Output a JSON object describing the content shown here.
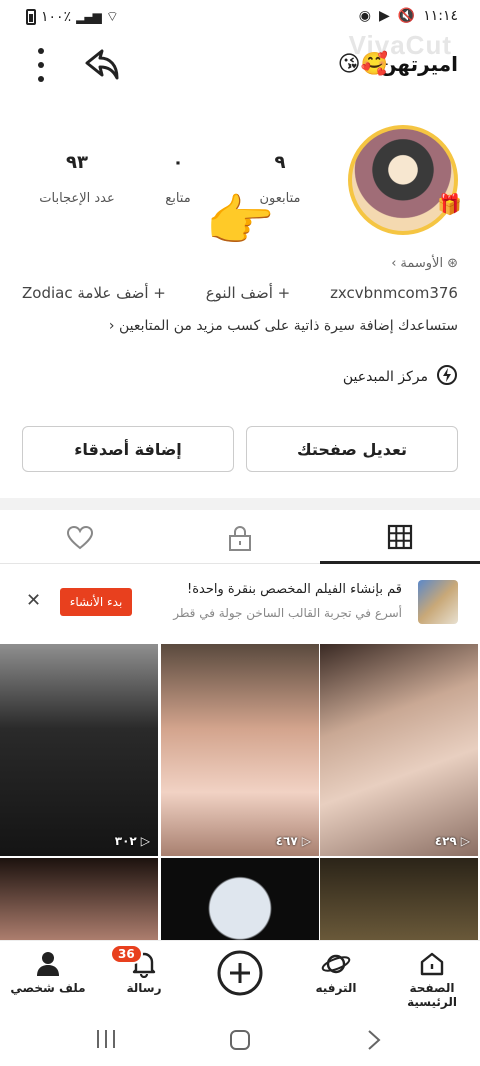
{
  "status": {
    "battery": "١٠٠٪",
    "time": "١١:١٤"
  },
  "watermark": "VivaCut",
  "profile": {
    "username": "اميرتهن",
    "emojis": "😘🥰"
  },
  "stats": [
    {
      "num": "٩",
      "label": "متابعون"
    },
    {
      "num": "٠",
      "label": "متابع"
    },
    {
      "num": "٩٣",
      "label": "عدد الإعجابات"
    }
  ],
  "honors": "الأوسمة",
  "handle": "zxcvbnmcom376",
  "add_type": "+ أضف النوع",
  "add_tag": "+ أضف علامة Zodiac",
  "bio_hint": "ستساعدك إضافة سيرة ذاتية على كسب مزيد من المتابعين",
  "creator_center": "مركز المبدعين",
  "buttons": {
    "edit": "تعديل صفحتك",
    "add_friends": "إضافة أصدقاء"
  },
  "promo": {
    "title": "قم بإنشاء الفيلم المخصص بنقرة واحدة!",
    "subtitle": "أسرع في تجربة القالب الساخن جولة في قطر",
    "start": "بدء الأنشاء"
  },
  "videos": [
    {
      "views": "٤٢٩"
    },
    {
      "views": "٤٦٧"
    },
    {
      "views": "٣٠٢"
    }
  ],
  "nav": {
    "home": "الصفحة الرئيسية",
    "entertainment": "الترفيه",
    "messages": "رسالة",
    "profile": "ملف شخصي",
    "badge": "36"
  }
}
